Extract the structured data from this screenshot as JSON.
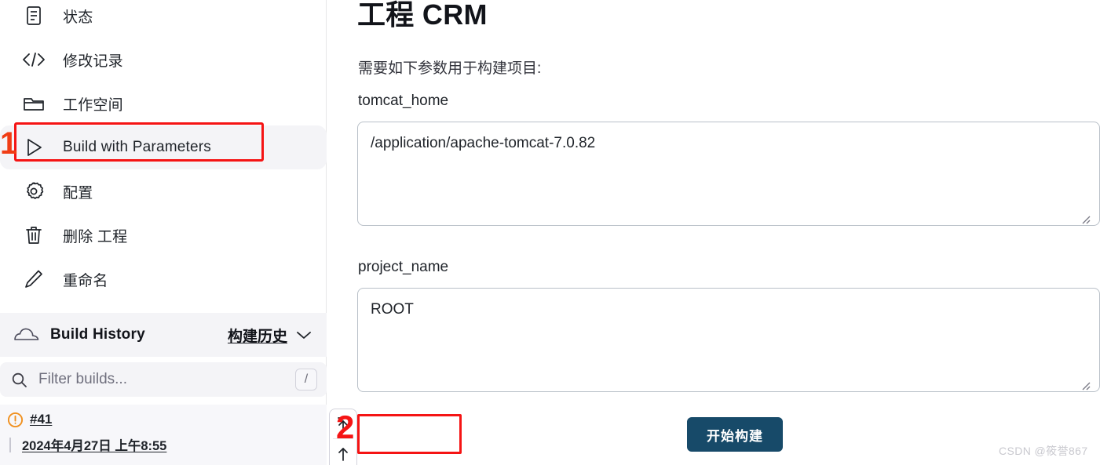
{
  "sidebar": {
    "nav_items": [
      {
        "label": "状态",
        "icon": "document-icon",
        "active": false
      },
      {
        "label": "修改记录",
        "icon": "code-brackets-icon",
        "active": false
      },
      {
        "label": "工作空间",
        "icon": "folder-icon",
        "active": false
      },
      {
        "label": "Build with Parameters",
        "icon": "play-triangle-icon",
        "active": true
      },
      {
        "label": "配置",
        "icon": "gear-icon",
        "active": false
      },
      {
        "label": "删除 工程",
        "icon": "trash-icon",
        "active": false
      },
      {
        "label": "重命名",
        "icon": "pencil-icon",
        "active": false
      }
    ],
    "build_history": {
      "title": "Build History",
      "title_cn": "构建历史",
      "cloud_icon": "cloud-icon",
      "chevron_icon": "chevron-down-icon",
      "filter_placeholder": "Filter builds...",
      "filter_value": "",
      "search_icon": "search-icon",
      "shortcut_key": "/",
      "builds": [
        {
          "number": "#41",
          "timestamp": "2024年4月27日 上午8:55",
          "status_icon": "warning-circle-icon",
          "status_color": "#f0901e"
        }
      ]
    }
  },
  "main": {
    "title": "工程 CRM",
    "intro": "需要如下参数用于构建项目:",
    "parameters": [
      {
        "label": "tomcat_home",
        "value": "/application/apache-tomcat-7.0.82"
      },
      {
        "label": "project_name",
        "value": "ROOT"
      }
    ],
    "build_button_label": "开始构建",
    "scroll_top_icon": "scroll-to-top-icon",
    "scroll_up_icon": "arrow-up-icon"
  },
  "annotations": [
    {
      "number": "1",
      "color": "#f03c14",
      "target": "Build with Parameters"
    },
    {
      "number": "2",
      "color": "#f51414",
      "target": "开始构建"
    }
  ],
  "watermark": "CSDN @筱誉867",
  "colors": {
    "accent_button": "#174a69",
    "annotation_red": "#f51414",
    "sidebar_active_bg": "#f4f4f7",
    "warning_orange": "#f0901e"
  }
}
